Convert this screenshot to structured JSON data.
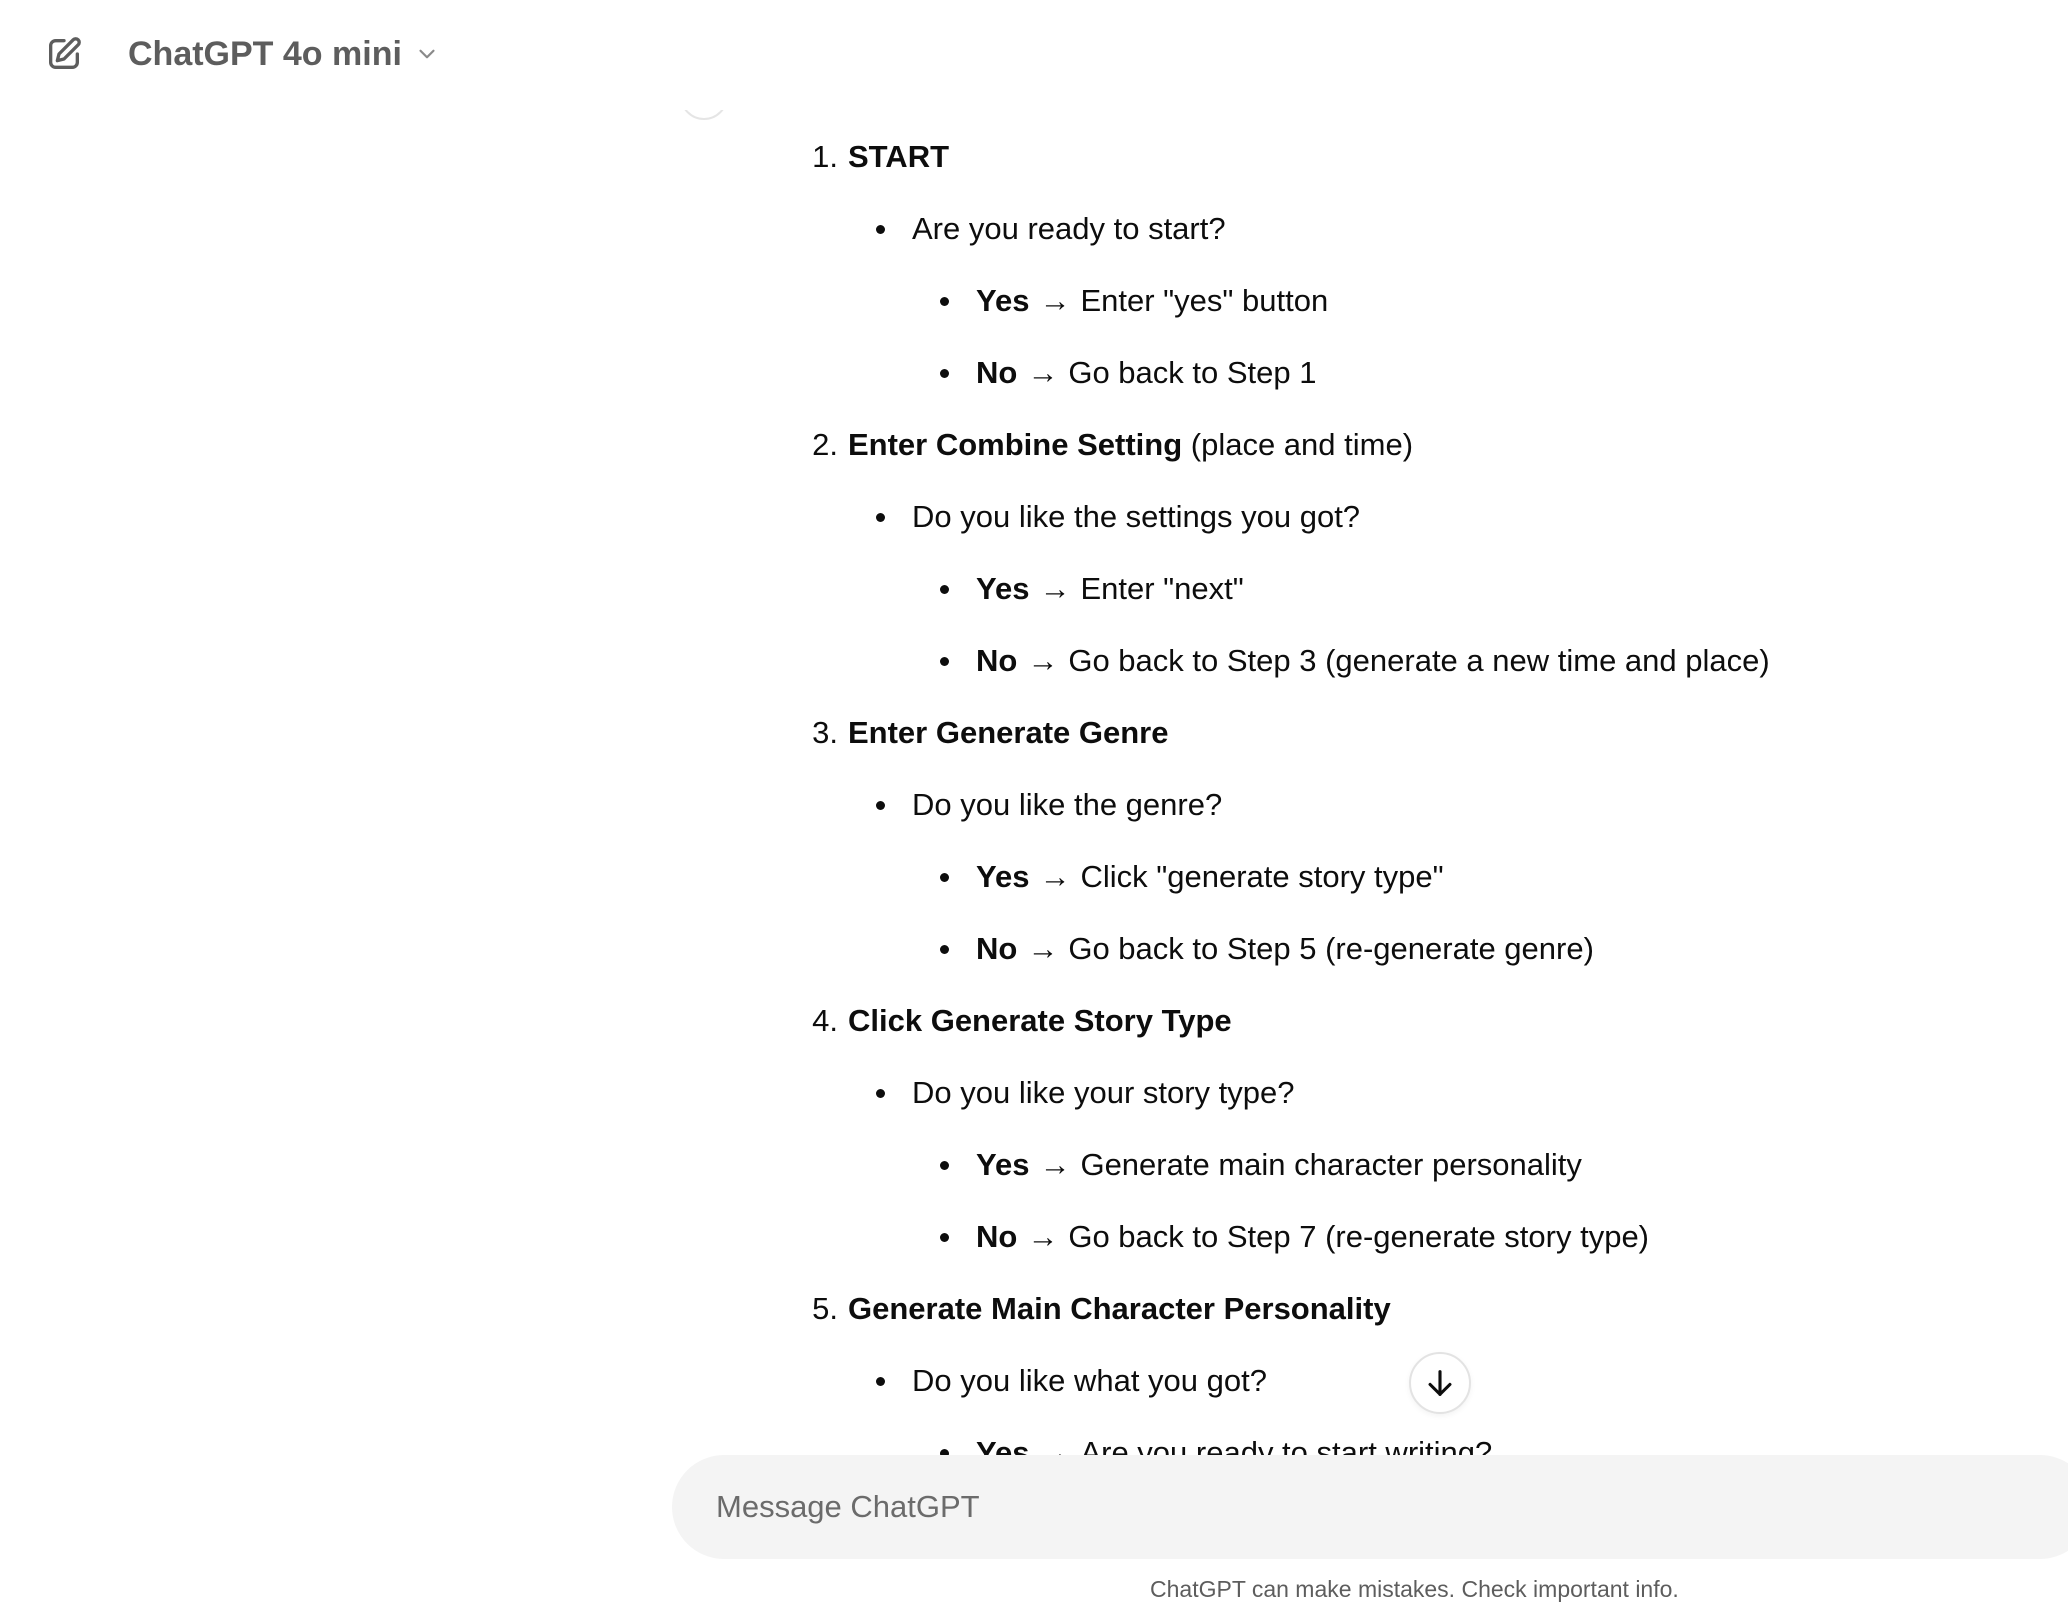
{
  "header": {
    "model_name": "ChatGPT 4o mini"
  },
  "message": {
    "steps": [
      {
        "number": "1.",
        "title": "START",
        "suffix": "",
        "question": "Are you ready to start?",
        "yes_label": "Yes",
        "yes_text": "Enter \"yes\" button",
        "no_label": "No",
        "no_text": "Go back to Step 1"
      },
      {
        "number": "2.",
        "title": "Enter Combine Setting",
        "suffix": " (place and time)",
        "question": "Do you like the settings you got?",
        "yes_label": "Yes",
        "yes_text": "Enter \"next\"",
        "no_label": "No",
        "no_text": "Go back to Step 3 (generate a new time and place)"
      },
      {
        "number": "3.",
        "title": "Enter Generate Genre",
        "suffix": "",
        "question": "Do you like the genre?",
        "yes_label": "Yes",
        "yes_text": "Click \"generate story type\"",
        "no_label": "No",
        "no_text": "Go back to Step 5 (re-generate genre)"
      },
      {
        "number": "4.",
        "title": "Click Generate Story Type",
        "suffix": "",
        "question": "Do you like your story type?",
        "yes_label": "Yes",
        "yes_text": "Generate main character personality",
        "no_label": "No",
        "no_text": "Go back to Step 7 (re-generate story type)"
      },
      {
        "number": "5.",
        "title": "Generate Main Character Personality",
        "suffix": "",
        "question": "Do you like what you got?",
        "yes_label": "Yes",
        "yes_text": "Are you ready to start writing?"
      }
    ],
    "arrow": "→"
  },
  "icons": {
    "new_chat": "new-chat-edit-icon",
    "model_dropdown": "chevron-down-icon",
    "scroll_down": "arrow-down-icon"
  },
  "composer": {
    "placeholder": "Message ChatGPT"
  },
  "footer": {
    "disclaimer": "ChatGPT can make mistakes. Check important info."
  }
}
